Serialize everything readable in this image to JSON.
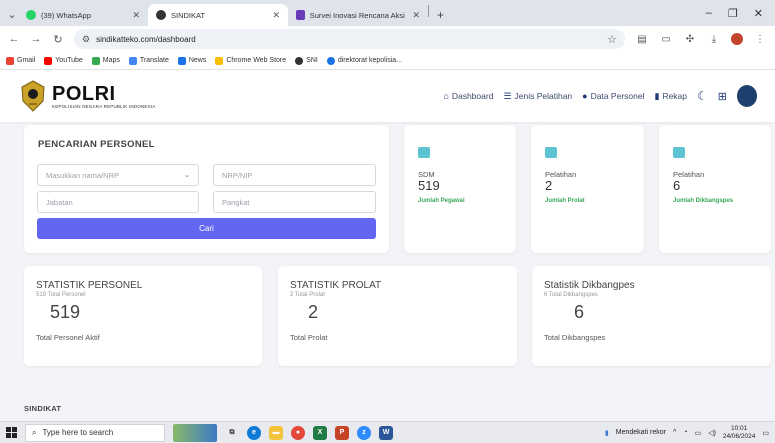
{
  "browser": {
    "tabs": [
      {
        "title": "(39) WhatsApp",
        "color": "#25d366"
      },
      {
        "title": "SINDIKAT",
        "color": "#333333"
      },
      {
        "title": "Survei Inovasi Rencana Aksi Pe...",
        "color": "#673ab7"
      }
    ],
    "new_tab": "+",
    "url": "sindikatteko.com/dashboard",
    "bookmarks": [
      {
        "label": "Gmail",
        "color": "#ea4335"
      },
      {
        "label": "YouTube",
        "color": "#ff0000"
      },
      {
        "label": "Maps",
        "color": "#34a853"
      },
      {
        "label": "Translate",
        "color": "#4285f4"
      },
      {
        "label": "News",
        "color": "#1a73e8"
      },
      {
        "label": "Chrome Web Store",
        "color": "#fbbc04"
      },
      {
        "label": "SNI",
        "color": "#333333"
      },
      {
        "label": "direktorat kepolisia...",
        "color": "#1a73e8"
      }
    ]
  },
  "header": {
    "brand": "POLRI",
    "brand_sub": "KEPOLISIAN NEGARA REPUBLIK INDONESIA",
    "nav": [
      {
        "label": "Dashboard",
        "icon": "home-icon"
      },
      {
        "label": "Jenis Pelatihan",
        "icon": "list-icon"
      },
      {
        "label": "Data Personel",
        "icon": "user-icon"
      },
      {
        "label": "Rekap",
        "icon": "chart-icon"
      }
    ]
  },
  "search": {
    "title": "PENCARIAN PERSONEL",
    "name_placeholder": "Masukkan nama/NRP",
    "nrp_placeholder": "NRP/NIP",
    "jabatan_placeholder": "Jabatan",
    "pangkat_placeholder": "Pangkat",
    "button": "Cari",
    "button_color": "#6366f1"
  },
  "stats": [
    {
      "label": "SDM",
      "value": "519",
      "sub": "Jumlah Pegawai"
    },
    {
      "label": "Pelatihan",
      "value": "2",
      "sub": "Jumlah Prolat"
    },
    {
      "label": "Pelatihan",
      "value": "6",
      "sub": "Jumlah Dikbangspes"
    }
  ],
  "statistics": [
    {
      "title": "STATISTIK PERSONEL",
      "caption": "519 Total Personel",
      "value": "519",
      "footer": "Total Personel Aktif"
    },
    {
      "title": "STATISTIK PROLAT",
      "caption": "2 Total Prolat",
      "value": "2",
      "footer": "Total Prolat"
    },
    {
      "title": "Statistik Dikbangpes",
      "caption": "6 Total Dikbangspes",
      "value": "6",
      "footer": "Total Dikbangspes"
    }
  ],
  "section_title": "SINDIKAT",
  "taskbar": {
    "search_placeholder": "Type here to search",
    "news": "Mendekati rekor",
    "time": "10:01",
    "date": "24/06/2024"
  }
}
